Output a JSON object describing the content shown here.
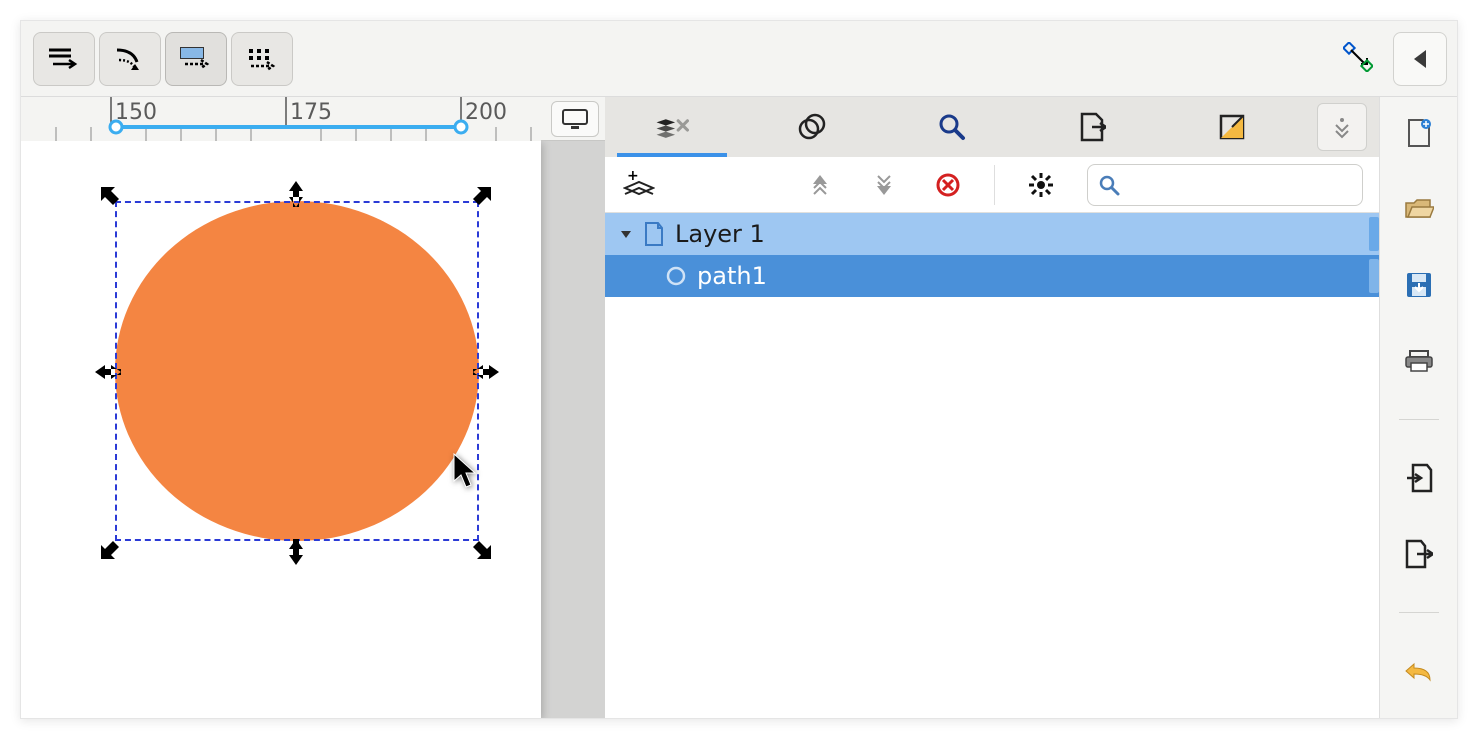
{
  "toolbar": {
    "snap_buttons": [
      "snap1",
      "snap2",
      "snap3",
      "snap4"
    ]
  },
  "ruler": {
    "ticks": [
      "150",
      "175",
      "200"
    ]
  },
  "layers_panel": {
    "search_placeholder": "",
    "tree": {
      "layer_name": "Layer 1",
      "object_name": "path1"
    }
  },
  "canvas": {
    "shape_color": "#f48542",
    "selection_color": "#2b3bd6"
  }
}
